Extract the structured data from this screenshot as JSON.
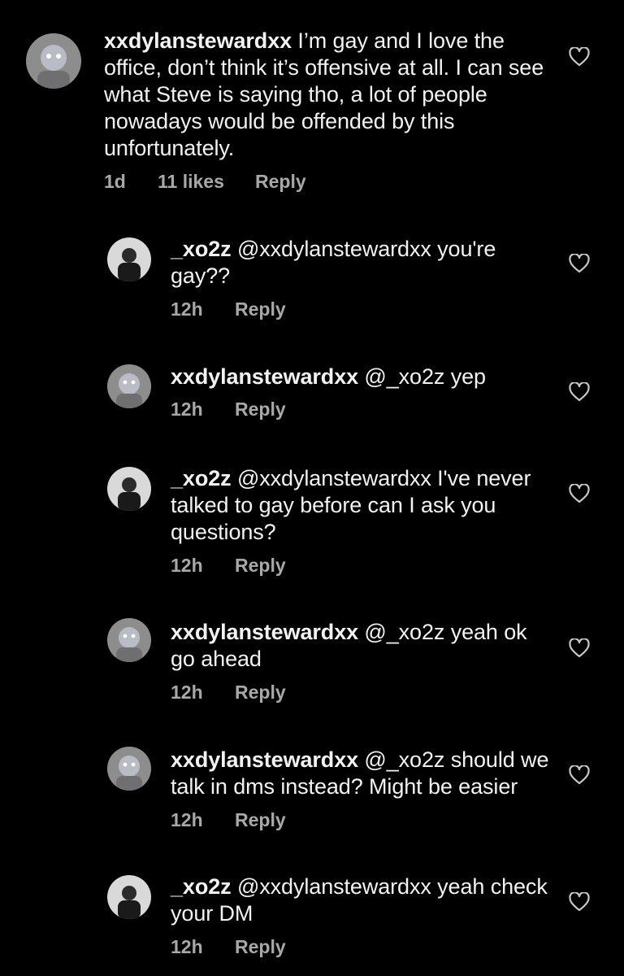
{
  "comments": [
    {
      "avatar": "dylan",
      "username": "xxdylanstewardxx",
      "text": " I’m gay and I love the office, don’t think it’s offensive at all. I can see what Steve is saying tho, a lot of people nowadays would be offended by this unfortunately.",
      "time": "1d",
      "likes": "11 likes",
      "reply": "Reply"
    },
    {
      "avatar": "xo2z",
      "username": "_xo2z",
      "text": " @xxdylanstewardxx you're gay??",
      "time": "12h",
      "reply": "Reply"
    },
    {
      "avatar": "dylan",
      "username": "xxdylanstewardxx",
      "text": " @_xo2z yep",
      "time": "12h",
      "reply": "Reply"
    },
    {
      "avatar": "xo2z",
      "username": "_xo2z",
      "text": " @xxdylanstewardxx I've never talked to gay before can I ask you questions?",
      "time": "12h",
      "reply": "Reply"
    },
    {
      "avatar": "dylan",
      "username": "xxdylanstewardxx",
      "text": " @_xo2z yeah ok go ahead",
      "time": "12h",
      "reply": "Reply"
    },
    {
      "avatar": "dylan",
      "username": "xxdylanstewardxx",
      "text": " @_xo2z should we talk in dms instead? Might be easier",
      "time": "12h",
      "reply": "Reply"
    },
    {
      "avatar": "xo2z",
      "username": "_xo2z",
      "text": " @xxdylanstewardxx yeah check your DM",
      "time": "12h",
      "reply": "Reply"
    }
  ],
  "icons": {
    "like": "heart-outline-icon"
  },
  "colors": {
    "background": "#000000",
    "text": "#f2f2f2",
    "secondary": "#a8a8a8"
  }
}
